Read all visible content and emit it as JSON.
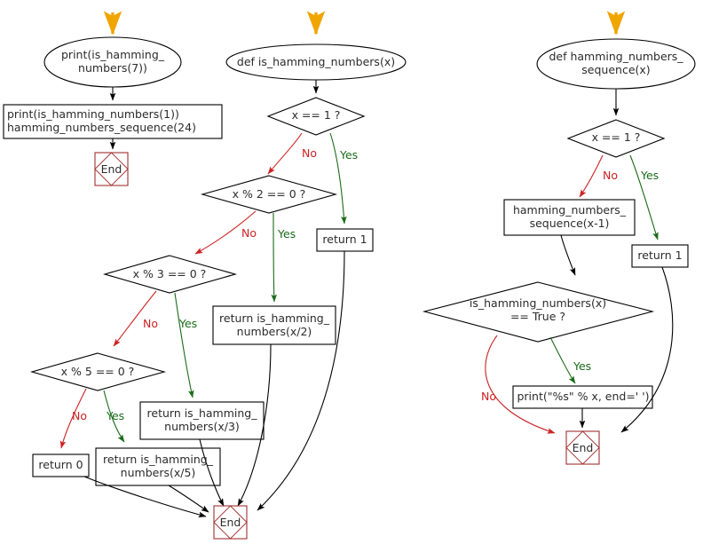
{
  "diagram": {
    "title": "Python flowchart: is_hamming_numbers / hamming_numbers_sequence",
    "colors": {
      "stroke": "#000000",
      "text": "#2b2b2b",
      "yes": "#1a6b1a",
      "no": "#cc2222",
      "entry_arrow": "#f0a500",
      "end_box": "#a03030",
      "background": "#ffffff"
    },
    "charts": [
      {
        "id": "main-driver",
        "nodes": {
          "start": "print(is_hamming_\nnumbers(7))",
          "process": "print(is_hamming_numbers(1))\nhamming_numbers_sequence(24)",
          "end": "End"
        }
      },
      {
        "id": "is-hamming-numbers",
        "nodes": {
          "start": "def is_hamming_numbers(x)",
          "d1": "x == 1 ?",
          "d2": "x % 2 == 0 ?",
          "d3": "x % 3 == 0 ?",
          "d4": "x % 5 == 0 ?",
          "return1": "return 1",
          "return_x2": "return is_hamming_\nnumbers(x/2)",
          "return_x3": "return is_hamming_\nnumbers(x/3)",
          "return_x5": "return is_hamming_\nnumbers(x/5)",
          "return0": "return 0",
          "end": "End"
        },
        "edge_labels": {
          "d1_no": "No",
          "d1_yes": "Yes",
          "d2_no": "No",
          "d2_yes": "Yes",
          "d3_no": "No",
          "d3_yes": "Yes",
          "d4_no": "No",
          "d4_yes": "Yes"
        }
      },
      {
        "id": "hamming-numbers-sequence",
        "nodes": {
          "start": "def hamming_numbers_\nsequence(x)",
          "d1": "x == 1 ?",
          "recurse": "hamming_numbers_\nsequence(x-1)",
          "return1": "return 1",
          "d2": "is_hamming_numbers(x)\n== True ?",
          "print": "print(\"%s\" % x, end=' ')",
          "end": "End"
        },
        "edge_labels": {
          "d1_no": "No",
          "d1_yes": "Yes",
          "d2_no": "No",
          "d2_yes": "Yes"
        }
      }
    ]
  }
}
